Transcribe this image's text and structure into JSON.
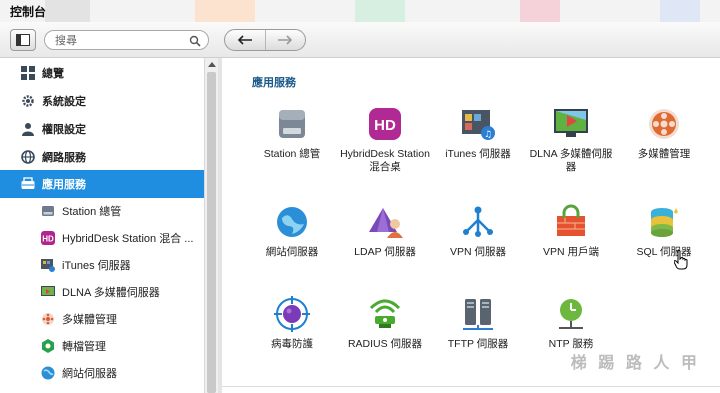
{
  "titlebar": {
    "title": "控制台"
  },
  "toolbar": {
    "search_placeholder": "搜尋"
  },
  "sidebar": {
    "items": [
      {
        "label": "總覽",
        "icon": "grid-icon"
      },
      {
        "label": "系統設定",
        "icon": "gear-icon"
      },
      {
        "label": "權限設定",
        "icon": "user-icon"
      },
      {
        "label": "網路服務",
        "icon": "network-globe-icon"
      },
      {
        "label": "應用服務",
        "icon": "app-services-icon",
        "selected": true
      },
      {
        "label": "Station 總管",
        "icon": "drive-icon"
      },
      {
        "label": "HybridDesk Station 混合 ...",
        "icon": "hd-icon"
      },
      {
        "label": "iTunes 伺服器",
        "icon": "itunes-icon"
      },
      {
        "label": "DLNA 多媒體伺服器",
        "icon": "dlna-icon"
      },
      {
        "label": "多媒體管理",
        "icon": "film-reel-icon"
      },
      {
        "label": "轉檔管理",
        "icon": "transcode-icon"
      },
      {
        "label": "網站伺服器",
        "icon": "web-globe-icon"
      }
    ]
  },
  "main": {
    "heading": "應用服務",
    "apps": [
      {
        "label": "Station 總管"
      },
      {
        "label": "HybridDesk Station 混合桌"
      },
      {
        "label": "iTunes 伺服器"
      },
      {
        "label": "DLNA 多媒體伺服器"
      },
      {
        "label": "多媒體管理"
      },
      {
        "label": "網站伺服器"
      },
      {
        "label": "LDAP 伺服器"
      },
      {
        "label": "VPN 伺服器"
      },
      {
        "label": "VPN 用戶端"
      },
      {
        "label": "SQL 伺服器"
      },
      {
        "label": "病毒防護"
      },
      {
        "label": "RADIUS 伺服器"
      },
      {
        "label": "TFTP 伺服器"
      },
      {
        "label": "NTP 服務"
      }
    ]
  },
  "watermark": "梯 踢 路 人 甲"
}
